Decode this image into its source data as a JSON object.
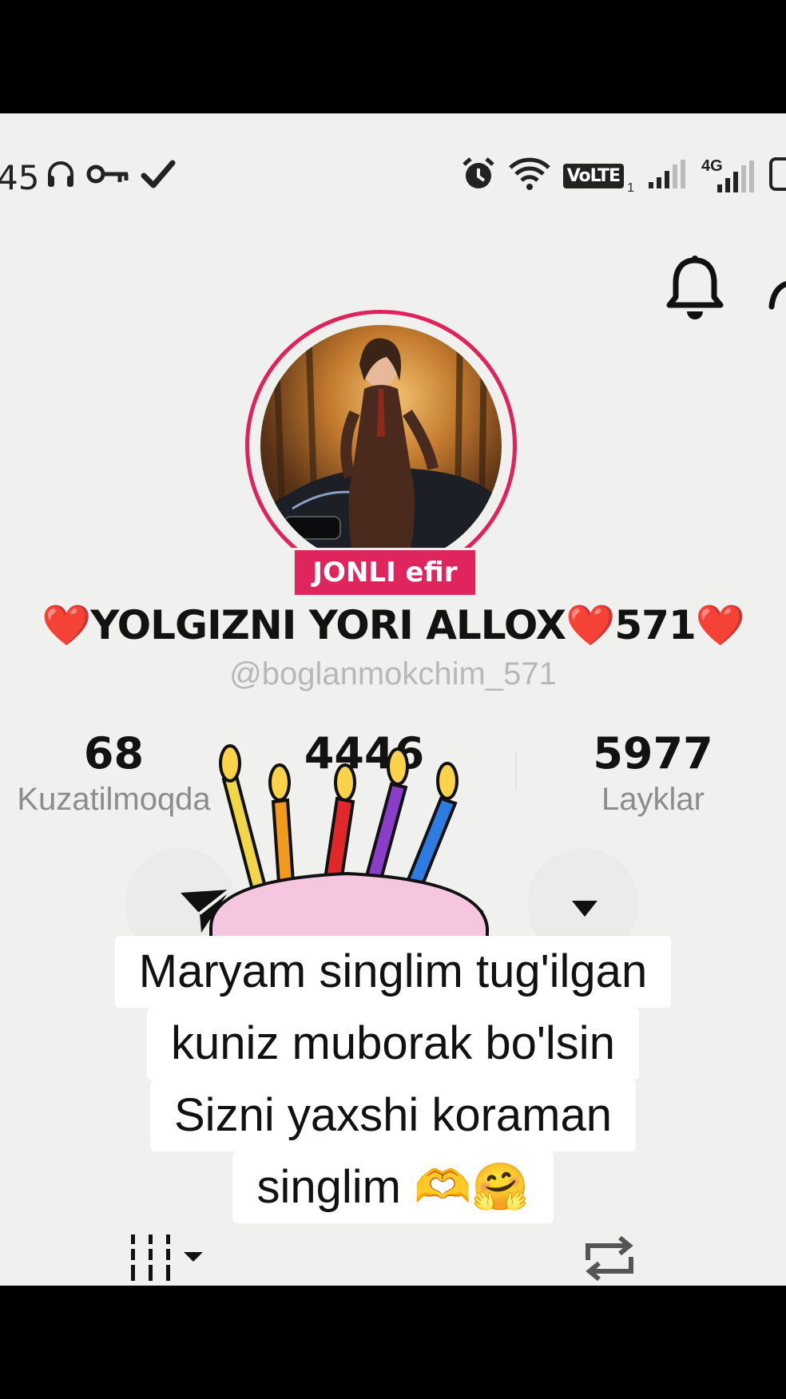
{
  "status_bar": {
    "time": "45",
    "left_icons": [
      "headphones-icon",
      "key-icon",
      "check-icon"
    ],
    "right_icons": [
      "alarm-icon",
      "wifi-icon",
      "volte-icon",
      "signal-icon",
      "signal-4g-icon",
      "battery-icon"
    ],
    "volte_label": "VoLTE",
    "volte_sub": "1",
    "network_label": "4G"
  },
  "header": {
    "notification_icon": "bell-icon"
  },
  "profile": {
    "live_badge": "JONLI efir",
    "display_name": "❤️YOLGIZNI YORI ALLOX❤️571❤️",
    "username": "@boglanmokchim_571",
    "accent_color": "#e0225c"
  },
  "stats": {
    "following": {
      "value": "68",
      "label": "Kuzatilmoqda"
    },
    "followers_partial": {
      "value": "4446"
    },
    "likes": {
      "value": "5977",
      "label": "Layklar"
    }
  },
  "actions": {
    "share_icon": "send-icon",
    "settings_icon": "gear-icon",
    "more_icon": "dropdown-icon"
  },
  "overlay": {
    "sticker": "birthday-cake-sticker",
    "caption_lines": [
      "Maryam singlim tug'ilgan",
      "kuniz muborak bo'lsin",
      "Sizni yaxshi koraman",
      "singlim 🫶🤗"
    ]
  },
  "tabs": {
    "grid_icon": "grid-icon",
    "repost_icon": "repost-icon"
  }
}
